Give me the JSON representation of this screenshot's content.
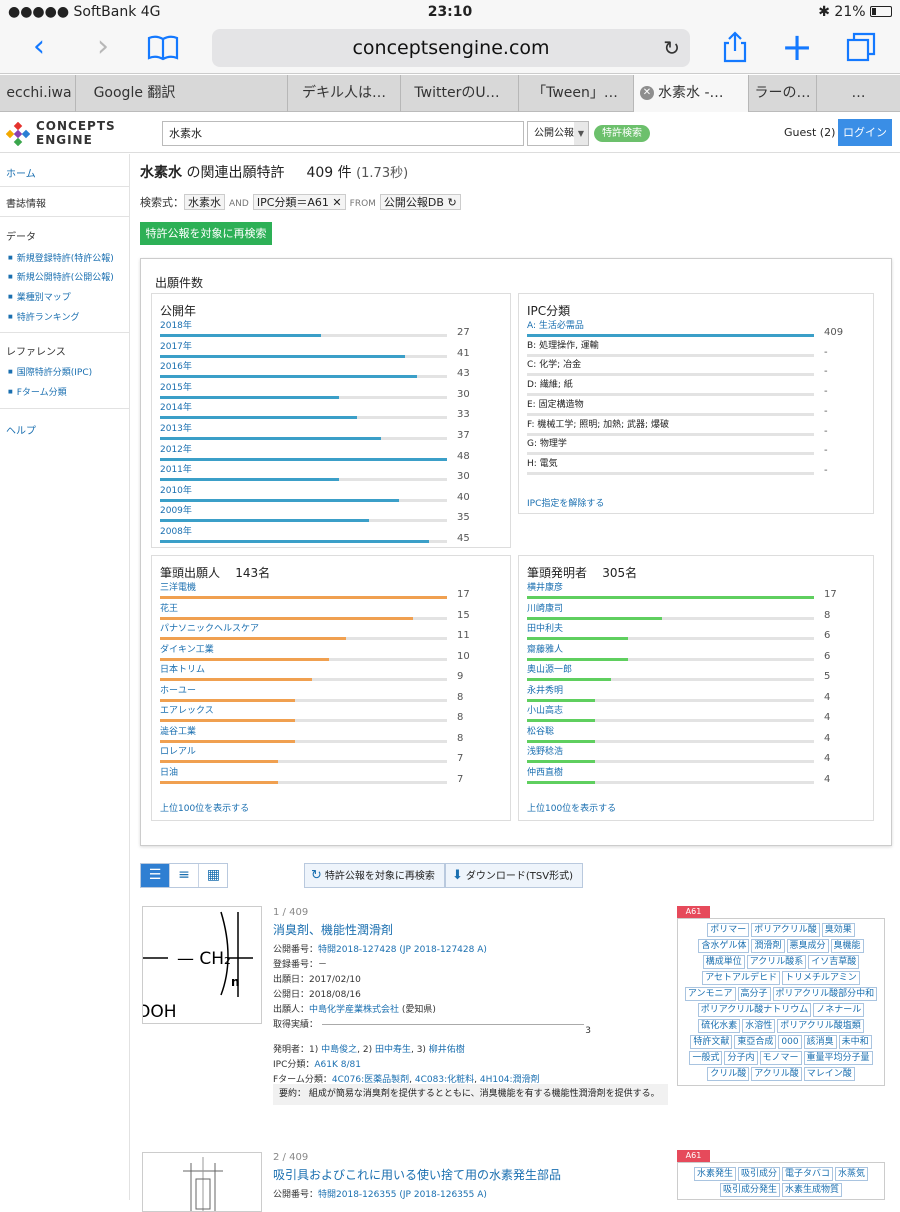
{
  "status": {
    "carrier": "●●●●● SoftBank  4G",
    "time": "23:10",
    "battery": "21%",
    "bt": "✱"
  },
  "browser": {
    "url": "conceptsengine.com",
    "tabs": [
      "ecchi.iwa",
      "Google 翻訳",
      "デキル人は…",
      "TwitterのU…",
      "「Tween」…",
      "水素水 -…",
      "ラーの…",
      "…"
    ]
  },
  "header": {
    "logo_line1": "CONCEPTS",
    "logo_line2": "ENGINE",
    "query": "水素水",
    "db": "公開公報",
    "patent_search": "特許検索",
    "guest": "Guest (2)",
    "login": "ログイン"
  },
  "sidebar": {
    "home": "ホーム",
    "biblio": "書誌情報",
    "data": "データ",
    "data_items": [
      "新規登録特許(特許公報)",
      "新規公開特許(公開公報)",
      "業種別マップ",
      "特許ランキング"
    ],
    "reference": "レファレンス",
    "ref_items": [
      "国際特許分類(IPC)",
      "Fターム分類"
    ],
    "help": "ヘルプ"
  },
  "main": {
    "title_term": "水素水",
    "title_suffix": " の関連出願特許",
    "count": "409 件",
    "secs": "(1.73秒)",
    "formula": {
      "label": "検索式：",
      "term": "水素水",
      "and": "AND",
      "ipc": "IPC分類＝A61",
      "x": "✕",
      "from": "FROM",
      "db": "公開公報DB",
      "refresh": "↻"
    },
    "research": "特許公報を対象に再検索"
  },
  "stats": {
    "title": "出願件数",
    "year": {
      "title": "公開年",
      "items": [
        {
          "label": "2018年",
          "value": 27
        },
        {
          "label": "2017年",
          "value": 41
        },
        {
          "label": "2016年",
          "value": 43
        },
        {
          "label": "2015年",
          "value": 30
        },
        {
          "label": "2014年",
          "value": 33
        },
        {
          "label": "2013年",
          "value": 37
        },
        {
          "label": "2012年",
          "value": 48
        },
        {
          "label": "2011年",
          "value": 30
        },
        {
          "label": "2010年",
          "value": 40
        },
        {
          "label": "2009年",
          "value": 35
        },
        {
          "label": "2008年",
          "value": 45
        }
      ]
    },
    "ipc": {
      "title": "IPC分類",
      "items": [
        {
          "label": "A: 生活必需品",
          "value": "409",
          "ratio": 1
        },
        {
          "label": "B: 処理操作, 運輸",
          "value": "-",
          "ratio": 0
        },
        {
          "label": "C: 化学; 冶金",
          "value": "-",
          "ratio": 0
        },
        {
          "label": "D: 繊維; 紙",
          "value": "-",
          "ratio": 0
        },
        {
          "label": "E: 固定構造物",
          "value": "-",
          "ratio": 0
        },
        {
          "label": "F: 機械工学; 照明; 加熱; 武器; 爆破",
          "value": "-",
          "ratio": 0
        },
        {
          "label": "G: 物理学",
          "value": "-",
          "ratio": 0
        },
        {
          "label": "H: 電気",
          "value": "-",
          "ratio": 0
        }
      ],
      "footer": "IPC指定を解除する"
    },
    "applicants": {
      "title": "筆頭出願人",
      "count": "143名",
      "items": [
        {
          "label": "三洋電機",
          "value": 17
        },
        {
          "label": "花王",
          "value": 15
        },
        {
          "label": "パナソニックヘルスケア",
          "value": 11
        },
        {
          "label": "ダイキン工業",
          "value": 10
        },
        {
          "label": "日本トリム",
          "value": 9
        },
        {
          "label": "ホーユー",
          "value": 8
        },
        {
          "label": "エアレックス",
          "value": 8
        },
        {
          "label": "澁谷工業",
          "value": 8
        },
        {
          "label": "ロレアル",
          "value": 7
        },
        {
          "label": "日油",
          "value": 7
        }
      ],
      "footer": "上位100位を表示する"
    },
    "inventors": {
      "title": "筆頭発明者",
      "count": "305名",
      "items": [
        {
          "label": "横井康彦",
          "value": 17
        },
        {
          "label": "川崎康司",
          "value": 8
        },
        {
          "label": "田中利夫",
          "value": 6
        },
        {
          "label": "齋藤雅人",
          "value": 6
        },
        {
          "label": "奥山源一郎",
          "value": 5
        },
        {
          "label": "永井秀明",
          "value": 4
        },
        {
          "label": "小山高志",
          "value": 4
        },
        {
          "label": "松谷聡",
          "value": 4
        },
        {
          "label": "浅野稔浩",
          "value": 4
        },
        {
          "label": "仲西直樹",
          "value": 4
        }
      ],
      "footer": "上位100位を表示する"
    }
  },
  "toolbar": {
    "research": "特許公報を対象に再検索",
    "download": "ダウンロード(TSV形式)"
  },
  "results": [
    {
      "num": "1 / 409",
      "title": "消臭剤、機能性潤滑剤",
      "pubno_label": "公開番号：",
      "pubno": "特開2018-127428 (JP 2018-127428 A)",
      "regno": "登録番号：－",
      "filed": "出願日：2017/02/10",
      "pubdate": "公開日：2018/08/16",
      "applicant_label": "出願人：",
      "applicant": "中島化学産業株式会社",
      "applicant_loc": " (愛知県)",
      "acq": "取得実績：",
      "acq_val": "3",
      "inv_label": "発明者：1) ",
      "inv1": "中島俊之",
      "inv_sep2": ", 2) ",
      "inv2": "田中寿生",
      "inv_sep3": ", 3) ",
      "inv3": "柳井佑樹",
      "ipc_label": "IPC分類：",
      "ipc": "A61K 8/81",
      "f_label": "Fターム分類：",
      "f1": "4C076:医薬品製剤",
      "f2": "4C083:化粧料",
      "f3": "4H104:潤滑剤",
      "summary": "要約： 組成が簡易な消臭剤を提供するとともに、消臭機能を有する機能性潤滑剤を提供する。",
      "ipc_flag": "A61",
      "tags": [
        "ポリマー",
        "ポリアクリル酸",
        "臭効果",
        "含水ゲル体",
        "潤滑剤",
        "悪臭成分",
        "臭機能",
        "構成単位",
        "アクリル酸系",
        "イソ吉草酸",
        "アセトアルデヒド",
        "トリメチルアミン",
        "アンモニア",
        "高分子",
        "ポリアクリル酸部分中和",
        "ポリアクリル酸ナトリウム",
        "ノネナール",
        "硫化水素",
        "水溶性",
        "ポリアクリル酸塩類",
        "特許文献",
        "東亞合成",
        "000",
        "該消臭",
        "未中和",
        "一般式",
        "分子内",
        "モノマー",
        "重量平均分子量",
        "クリル酸",
        "アクリル酸",
        "マレイン酸"
      ],
      "thumb_ch2": "— CH₂",
      "thumb_n": "n",
      "thumb_ooh": "OOH"
    },
    {
      "num": "2 / 409",
      "title": "吸引具およびこれに用いる使い捨て用の水素発生部品",
      "pubno_label": "公開番号：",
      "pubno": "特開2018-126355 (JP 2018-126355 A)",
      "ipc_flag": "A61",
      "tags": [
        "水素発生",
        "吸引成分",
        "電子タバコ",
        "水蒸気",
        "吸引成分発生",
        "水素生成物質"
      ]
    }
  ]
}
